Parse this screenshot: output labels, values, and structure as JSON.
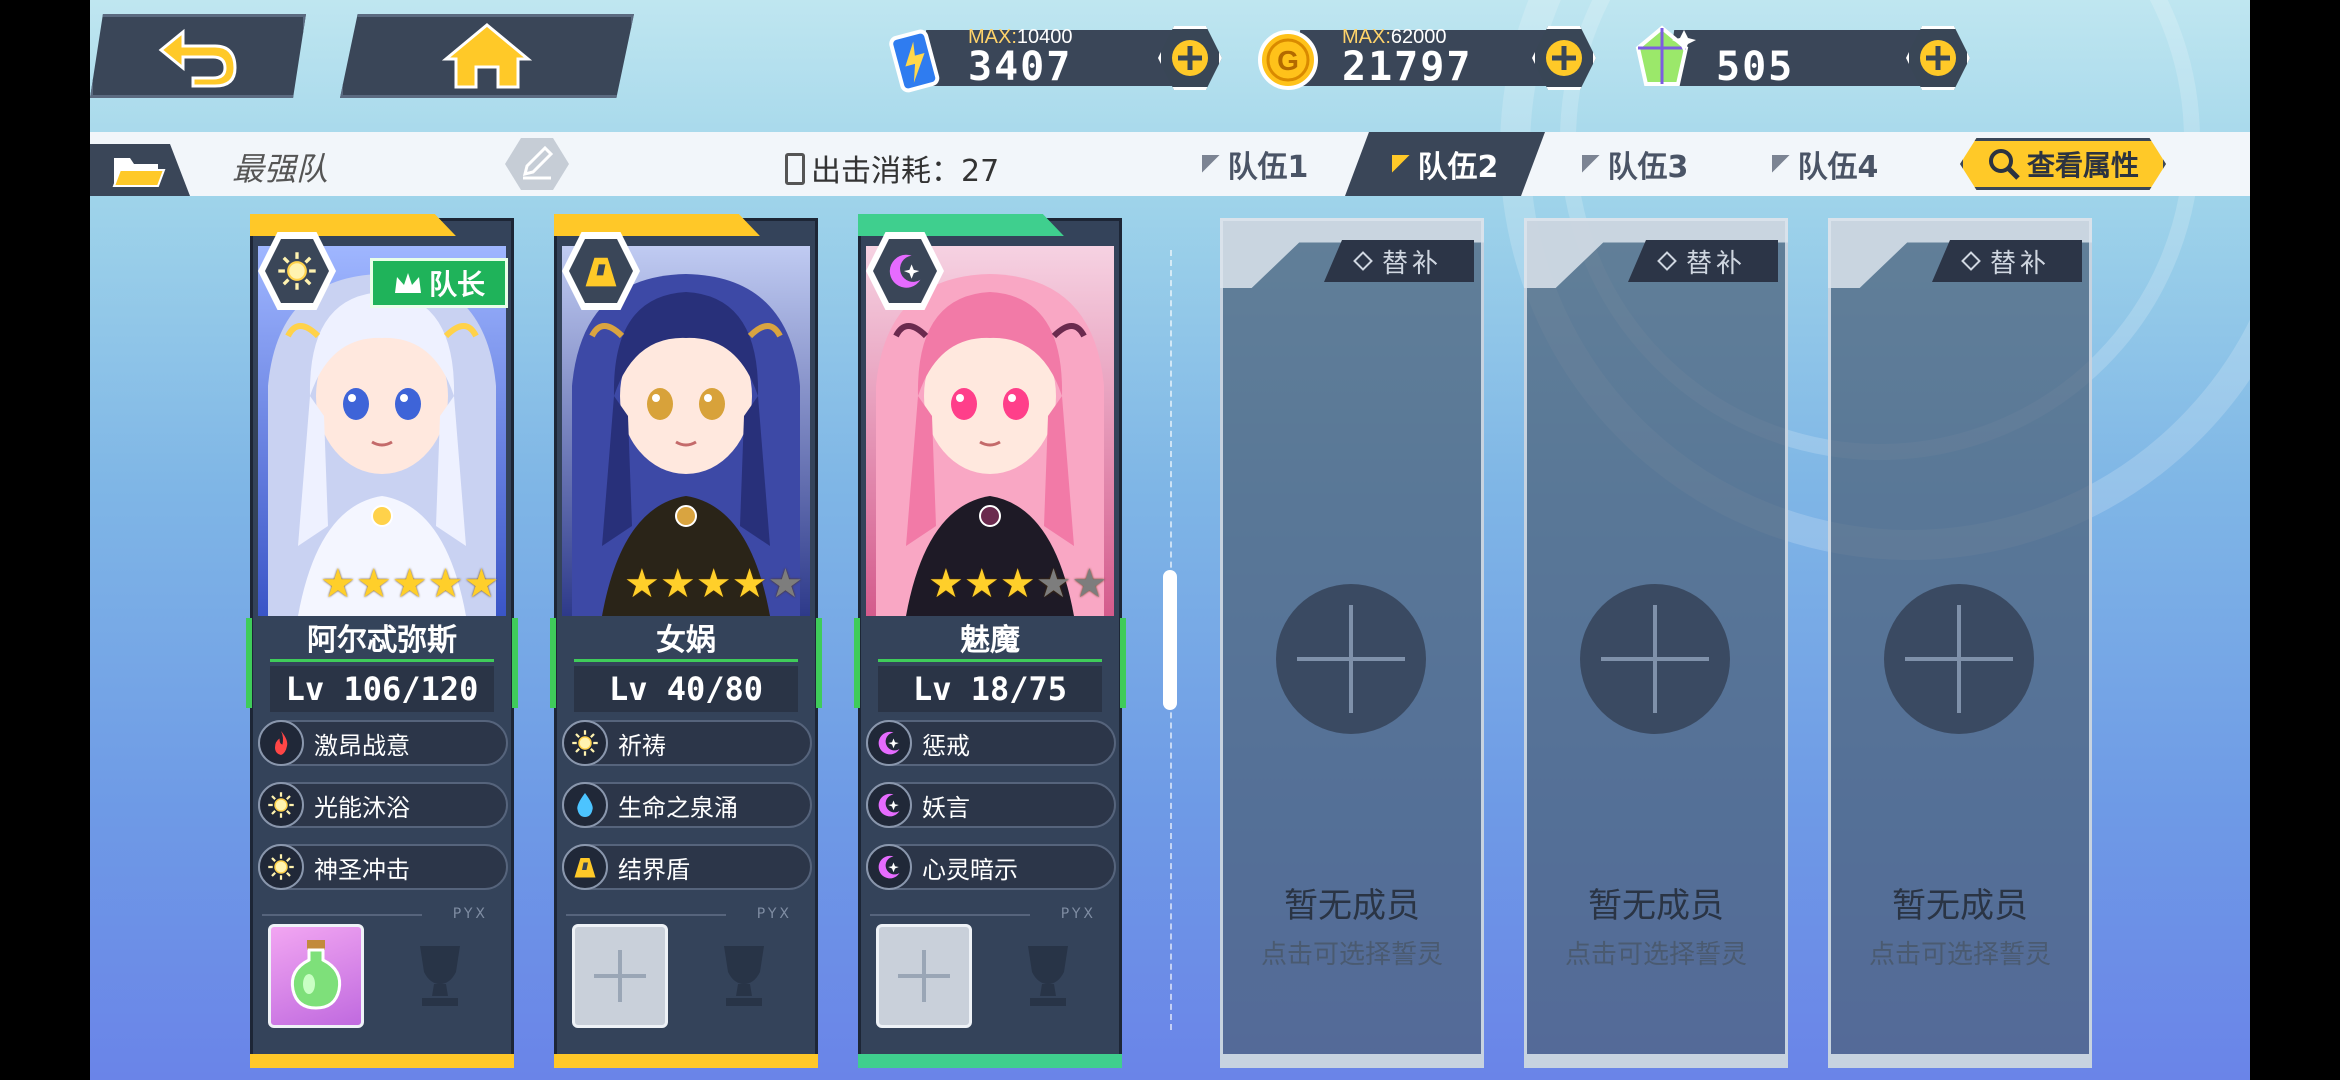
{
  "resources": [
    {
      "name": "stamina",
      "max_label": "MAX:",
      "max_value": "10400",
      "value": "3407",
      "icon": "battery-icon",
      "color": "#3a8cff"
    },
    {
      "name": "gold",
      "max_label": "MAX:",
      "max_value": "62000",
      "value": "21797",
      "icon": "gold-coin-icon",
      "color": "#ffc21a"
    },
    {
      "name": "gems",
      "max_label": "",
      "max_value": "",
      "value": "505",
      "icon": "crystal-icon",
      "color": "#9be86a"
    }
  ],
  "team": {
    "name": "最强队",
    "cost_label": "出击消耗：27",
    "tabs": [
      {
        "label": "队伍1",
        "active": false
      },
      {
        "label": "队伍2",
        "active": true
      },
      {
        "label": "队伍3",
        "active": false
      },
      {
        "label": "队伍4",
        "active": false
      }
    ],
    "view_attributes_label": "查看属性"
  },
  "members": [
    {
      "name": "阿尔忒弥斯",
      "level": "Lv 106/120",
      "stars": 5,
      "max_stars": 5,
      "element_icon": "sun-icon",
      "leader_label": "队长",
      "rarity_color": "#ffc828",
      "skills": [
        {
          "icon": "fire-icon",
          "label": "激昂战意"
        },
        {
          "icon": "sun-icon",
          "label": "光能沐浴"
        },
        {
          "icon": "sun-icon",
          "label": "神圣冲击"
        }
      ],
      "equip": "potion-icon",
      "pyx_label": "PYX"
    },
    {
      "name": "女娲",
      "level": "Lv 40/80",
      "stars": 4,
      "max_stars": 5,
      "element_icon": "earth-icon",
      "leader_label": "",
      "rarity_color": "#ffc828",
      "skills": [
        {
          "icon": "sun-icon",
          "label": "祈祷"
        },
        {
          "icon": "water-icon",
          "label": "生命之泉涌"
        },
        {
          "icon": "earth-icon",
          "label": "结界盾"
        }
      ],
      "equip": "",
      "pyx_label": "PYX"
    },
    {
      "name": "魅魔",
      "level": "Lv 18/75",
      "stars": 3,
      "max_stars": 5,
      "element_icon": "moon-icon",
      "leader_label": "",
      "rarity_color": "#3fcf8e",
      "skills": [
        {
          "icon": "moon-icon",
          "label": "惩戒"
        },
        {
          "icon": "moon-icon",
          "label": "妖言"
        },
        {
          "icon": "moon-icon",
          "label": "心灵暗示"
        }
      ],
      "equip": "",
      "pyx_label": "PYX"
    }
  ],
  "substitutes": [
    {
      "tag": "替补",
      "title": "暂无成员",
      "hint": "点击可选择誓灵"
    },
    {
      "tag": "替补",
      "title": "暂无成员",
      "hint": "点击可选择誓灵"
    },
    {
      "tag": "替补",
      "title": "暂无成员",
      "hint": "点击可选择誓灵"
    }
  ]
}
